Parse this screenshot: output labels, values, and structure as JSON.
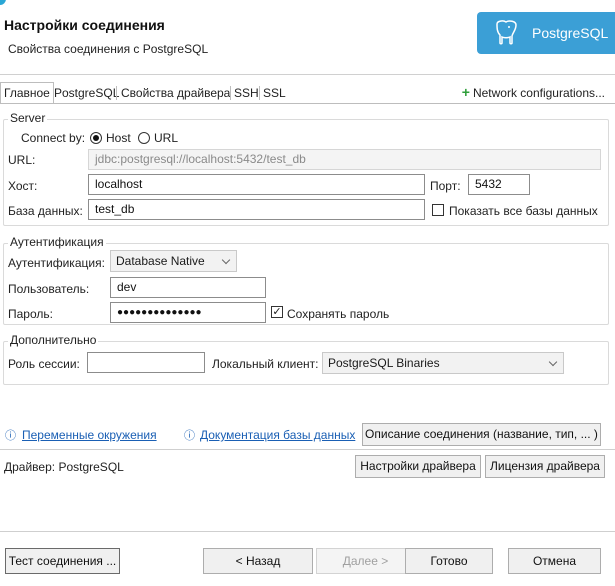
{
  "header": {
    "title": "Настройки соединения",
    "subtitle": "Свойства соединения с PostgreSQL",
    "logo_text": "PostgreSQL"
  },
  "tabs": [
    {
      "label": "Главное"
    },
    {
      "label": "PostgreSQL"
    },
    {
      "label": "Свойства драйвера"
    },
    {
      "label": "SSH"
    },
    {
      "label": "SSL"
    }
  ],
  "network_config_label": "Network configurations...",
  "server": {
    "group_label": "Server",
    "connect_by_label": "Connect by:",
    "option_host": "Host",
    "option_url": "URL",
    "url_label": "URL:",
    "url_value": "jdbc:postgresql://localhost:5432/test_db",
    "host_label": "Хост:",
    "host_value": "localhost",
    "port_label": "Порт:",
    "port_value": "5432",
    "database_label": "База данных:",
    "database_value": "test_db",
    "show_all_label": "Показать все базы данных"
  },
  "auth": {
    "group_label": "Аутентификация",
    "auth_label": "Аутентификация:",
    "auth_value": "Database Native",
    "user_label": "Пользователь:",
    "user_value": "dev",
    "password_label": "Пароль:",
    "password_value": "●●●●●●●●●●●●●●",
    "save_password_label": "Сохранять пароль"
  },
  "extra": {
    "group_label": "Дополнительно",
    "session_role_label": "Роль сессии:",
    "session_role_value": "",
    "local_client_label": "Локальный клиент:",
    "local_client_value": "PostgreSQL Binaries"
  },
  "links": {
    "env_vars": "Переменные окружения",
    "db_docs": "Документация базы данных",
    "describe_button": "Описание соединения (название, тип, ... )"
  },
  "driver": {
    "label": "Драйвер:",
    "name": "PostgreSQL",
    "settings_button": "Настройки драйвера",
    "license_button": "Лицензия драйвера"
  },
  "footer": {
    "test_button": "Тест соединения ...",
    "back_button": "< Назад",
    "next_button": "Далее >",
    "finish_button": "Готово",
    "cancel_button": "Отмена"
  },
  "colors": {
    "logo_bg": "#3b9fd6",
    "link": "#1a5fb4",
    "plus_icon": "#2f9e3a"
  }
}
